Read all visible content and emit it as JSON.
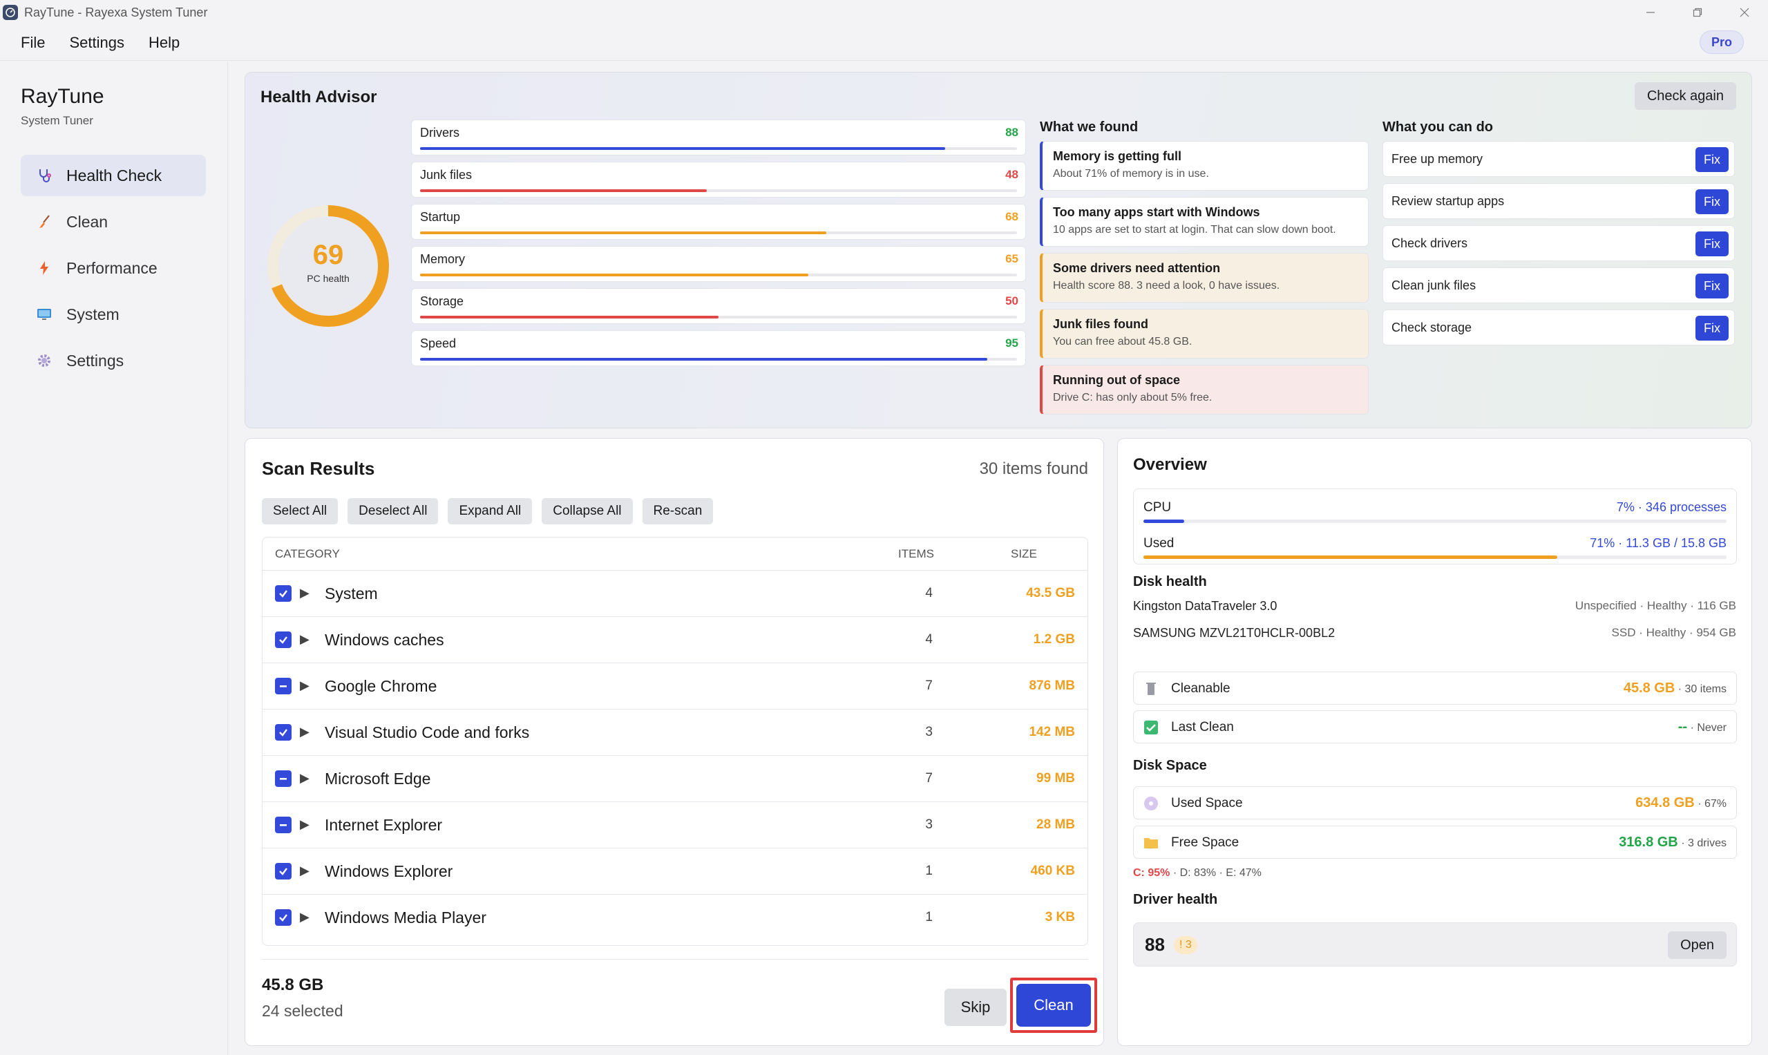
{
  "window": {
    "title": "RayTune - Rayexa System Tuner"
  },
  "menu": {
    "items": [
      "File",
      "Settings",
      "Help"
    ],
    "pro_badge": "Pro"
  },
  "sidebar": {
    "brand": "RayTune",
    "subtitle": "System Tuner",
    "items": [
      {
        "label": "Health Check",
        "icon": "stethoscope-icon",
        "active": true
      },
      {
        "label": "Clean",
        "icon": "broom-icon",
        "active": false
      },
      {
        "label": "Performance",
        "icon": "lightning-icon",
        "active": false
      },
      {
        "label": "System",
        "icon": "monitor-icon",
        "active": false
      },
      {
        "label": "Settings",
        "icon": "gear-icon",
        "active": false
      }
    ]
  },
  "advisor": {
    "title": "Health Advisor",
    "check_again": "Check again",
    "score": "69",
    "score_label": "PC health",
    "score_value": 69,
    "metrics": [
      {
        "name": "Drivers",
        "value": "88",
        "level": 88,
        "color": "#3349d9",
        "value_color": "#22a447"
      },
      {
        "name": "Junk files",
        "value": "48",
        "level": 48,
        "color": "#e04848",
        "value_color": "#e04848"
      },
      {
        "name": "Startup",
        "value": "68",
        "level": 68,
        "color": "#f0a020",
        "value_color": "#f0a020"
      },
      {
        "name": "Memory",
        "value": "65",
        "level": 65,
        "color": "#f0a020",
        "value_color": "#f0a020"
      },
      {
        "name": "Storage",
        "value": "50",
        "level": 50,
        "color": "#e04848",
        "value_color": "#e04848"
      },
      {
        "name": "Speed",
        "value": "95",
        "level": 95,
        "color": "#3349d9",
        "value_color": "#22a447"
      }
    ],
    "found_title": "What we found",
    "findings": [
      {
        "title": "Memory is getting full",
        "desc": "About 71% of memory is in use.",
        "accent": "#3349d9",
        "bg": "#ffffff"
      },
      {
        "title": "Too many apps start with Windows",
        "desc": "10 apps are set to start at login. That can slow down boot.",
        "accent": "#3349d9",
        "bg": "#ffffff"
      },
      {
        "title": "Some drivers need attention",
        "desc": "Health score 88. 3 need a look, 0 have issues.",
        "accent": "#f0a020",
        "bg": "#f7efe2"
      },
      {
        "title": "Junk files found",
        "desc": "You can free about 45.8 GB.",
        "accent": "#f0a020",
        "bg": "#f7efe2"
      },
      {
        "title": "Running out of space",
        "desc": "Drive C: has only about 5% free.",
        "accent": "#e04848",
        "bg": "#f8e8e8"
      }
    ],
    "todo_title": "What you can do",
    "actions": [
      {
        "label": "Free up memory",
        "button": "Fix"
      },
      {
        "label": "Review startup apps",
        "button": "Fix"
      },
      {
        "label": "Check drivers",
        "button": "Fix"
      },
      {
        "label": "Clean junk files",
        "button": "Fix"
      },
      {
        "label": "Check storage",
        "button": "Fix"
      }
    ]
  },
  "scan": {
    "title": "Scan Results",
    "count": "30 items found",
    "actions": [
      "Select All",
      "Deselect All",
      "Expand All",
      "Collapse All",
      "Re-scan"
    ],
    "columns": {
      "category": "CATEGORY",
      "items": "ITEMS",
      "size": "SIZE"
    },
    "rows": [
      {
        "name": "System",
        "items": "4",
        "size": "43.5 GB",
        "state": "checked"
      },
      {
        "name": "Windows caches",
        "items": "4",
        "size": "1.2 GB",
        "state": "checked"
      },
      {
        "name": "Google Chrome",
        "items": "7",
        "size": "876 MB",
        "state": "partial"
      },
      {
        "name": "Visual Studio Code and forks",
        "items": "3",
        "size": "142 MB",
        "state": "checked"
      },
      {
        "name": "Microsoft Edge",
        "items": "7",
        "size": "99 MB",
        "state": "partial"
      },
      {
        "name": "Internet Explorer",
        "items": "3",
        "size": "28 MB",
        "state": "partial"
      },
      {
        "name": "Windows Explorer",
        "items": "1",
        "size": "460 KB",
        "state": "checked"
      },
      {
        "name": "Windows Media Player",
        "items": "1",
        "size": "3 KB",
        "state": "checked"
      }
    ],
    "selected_size": "45.8 GB",
    "selected_count": "24 selected",
    "skip": "Skip",
    "clean": "Clean"
  },
  "overview": {
    "title": "Overview",
    "cpu": {
      "label": "CPU",
      "value": "7% · 346 processes",
      "level": 7
    },
    "memory": {
      "label": "Used",
      "value": "71% · 11.3 GB / 15.8 GB",
      "level": 71
    },
    "disk_health_title": "Disk health",
    "disks": [
      {
        "name": "Kingston DataTraveler 3.0",
        "status": "Unspecified · Healthy · 116 GB"
      },
      {
        "name": "SAMSUNG MZVL21T0HCLR-00BL2",
        "status": "SSD · Healthy · 954 GB"
      }
    ],
    "cleanable": {
      "label": "Cleanable",
      "value": "45.8 GB",
      "sub": " · 30 items",
      "color": "#f0a020",
      "icon": "trash-icon"
    },
    "last_clean": {
      "label": "Last Clean",
      "value": "--",
      "sub": " · Never",
      "color": "#22a447",
      "icon": "checkmark-icon"
    },
    "disk_space_title": "Disk Space",
    "used_space": {
      "label": "Used Space",
      "value": "634.8 GB",
      "sub": " · 67%",
      "color": "#f0a020",
      "icon": "disc-icon"
    },
    "free_space": {
      "label": "Free Space",
      "value": "316.8 GB",
      "sub": " · 3 drives",
      "color": "#22a447",
      "icon": "folder-icon"
    },
    "drives": [
      {
        "label": "C:",
        "value": "95%",
        "color": "#e04848"
      },
      {
        "label": "D:",
        "value": "83%",
        "color": "#555555"
      },
      {
        "label": "E:",
        "value": "47%",
        "color": "#555555"
      }
    ],
    "driver_health_title": "Driver health",
    "driver_score": "88",
    "driver_badge": "! 3",
    "open": "Open"
  }
}
